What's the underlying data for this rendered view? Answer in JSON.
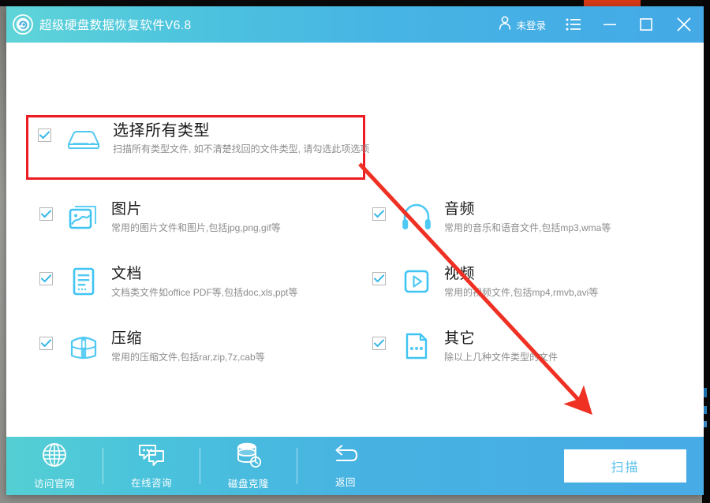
{
  "window": {
    "logo_icon": "disk-recovery-logo-icon",
    "title": "超级硬盘数据恢复软件V6.8",
    "login_icon": "user-icon",
    "login_label": "未登录",
    "menu_icon": "menu-list-icon",
    "minimize_icon": "minimize-icon",
    "maximize_icon": "maximize-icon",
    "close_icon": "close-icon",
    "accent_color": "#4ab8e2",
    "title_bar_gradient_from": "#5fd4d8",
    "title_bar_gradient_to": "#44a9e6",
    "highlight_color": "#ed1c24"
  },
  "file_types": [
    {
      "id": "all",
      "title": "选择所有类型",
      "desc": "扫描所有类型文件, 如不清楚找回的文件类型, 请勾选此项选项",
      "icon": "hard-disk-icon",
      "checked": true,
      "highlighted": true
    },
    {
      "id": "picture",
      "title": "图片",
      "desc": "常用的图片文件和图片,包括jpg,png,gif等",
      "icon": "picture-icon",
      "checked": true
    },
    {
      "id": "audio",
      "title": "音频",
      "desc": "常用的音乐和语音文件,包括mp3,wma等",
      "icon": "headphone-icon",
      "checked": true
    },
    {
      "id": "document",
      "title": "文档",
      "desc": "文档类文件如office PDF等,包括doc,xls,ppt等",
      "icon": "document-icon",
      "checked": true
    },
    {
      "id": "video",
      "title": "视频",
      "desc": "常用的视频文件,包括mp4,rmvb,avi等",
      "icon": "video-play-icon",
      "checked": true
    },
    {
      "id": "archive",
      "title": "压缩",
      "desc": "常用的压缩文件,包括rar,zip,7z,cab等",
      "icon": "archive-box-icon",
      "checked": true
    },
    {
      "id": "other",
      "title": "其它",
      "desc": "除以上几种文件类型的文件",
      "icon": "other-file-icon",
      "checked": true
    }
  ],
  "footer": {
    "items": [
      {
        "id": "website",
        "label": "访问官网",
        "icon": "globe-icon"
      },
      {
        "id": "consult",
        "label": "在线咨询",
        "icon": "chat-bubbles-icon"
      },
      {
        "id": "clone",
        "label": "磁盘克隆",
        "icon": "database-clone-icon"
      },
      {
        "id": "back",
        "label": "返回",
        "icon": "back-arrow-icon"
      }
    ],
    "scan_button_label": "扫描",
    "scan_button_text_color": "#5bc0ea"
  },
  "annotation": {
    "arrow_icon": "red-pointer-arrow",
    "color": "#ef3124",
    "points_to": "扫描"
  }
}
